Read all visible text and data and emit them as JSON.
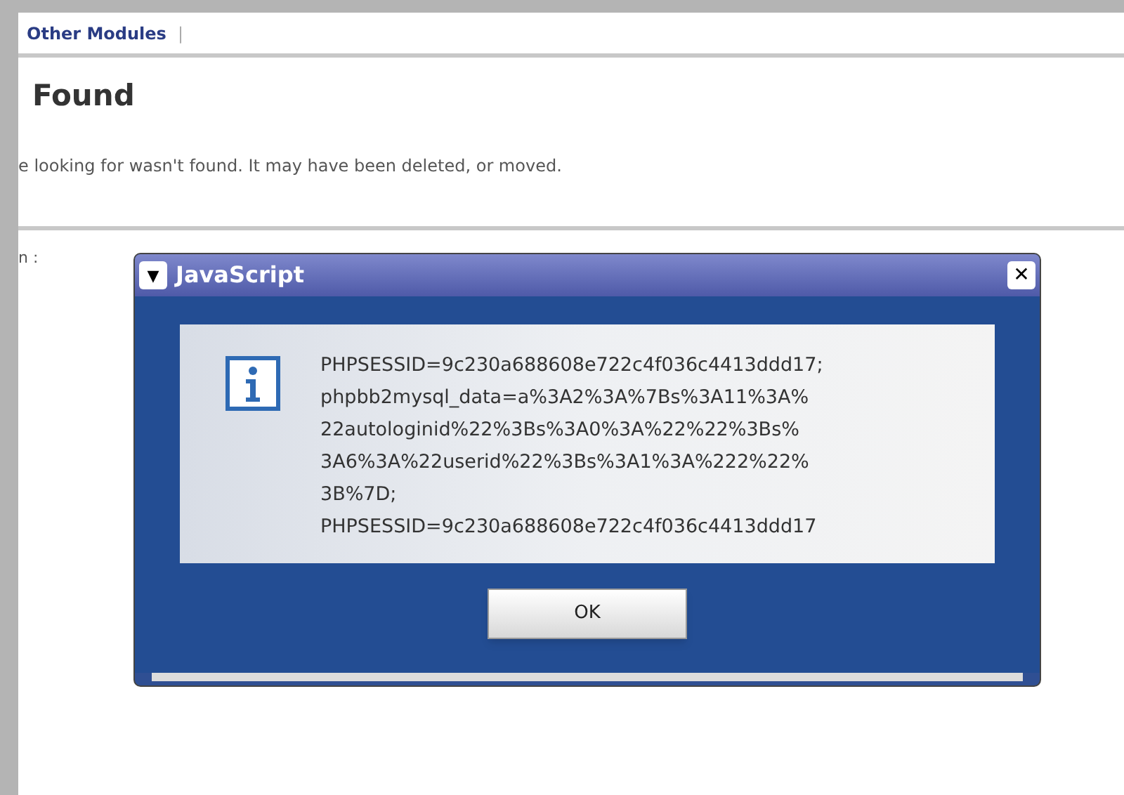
{
  "nav": {
    "link": "Other Modules",
    "separator": "|"
  },
  "page": {
    "heading": "Found",
    "message": "e looking for wasn't found. It may have been deleted, or moved.",
    "field_label": "n :"
  },
  "dialog": {
    "title": "JavaScript",
    "menu_symbol": "▼",
    "close_symbol": "✕",
    "message_lines": [
      "PHPSESSID=9c230a688608e722c4f036c4413ddd17;",
      "phpbb2mysql_data=a%3A2%3A%7Bs%3A11%3A%",
      "22autologinid%22%3Bs%3A0%3A%22%22%3Bs%",
      "3A6%3A%22userid%22%3Bs%3A1%3A%222%22%",
      "3B%7D;",
      "PHPSESSID=9c230a688608e722c4f036c4413ddd17"
    ],
    "buttons": [
      "OK"
    ]
  }
}
